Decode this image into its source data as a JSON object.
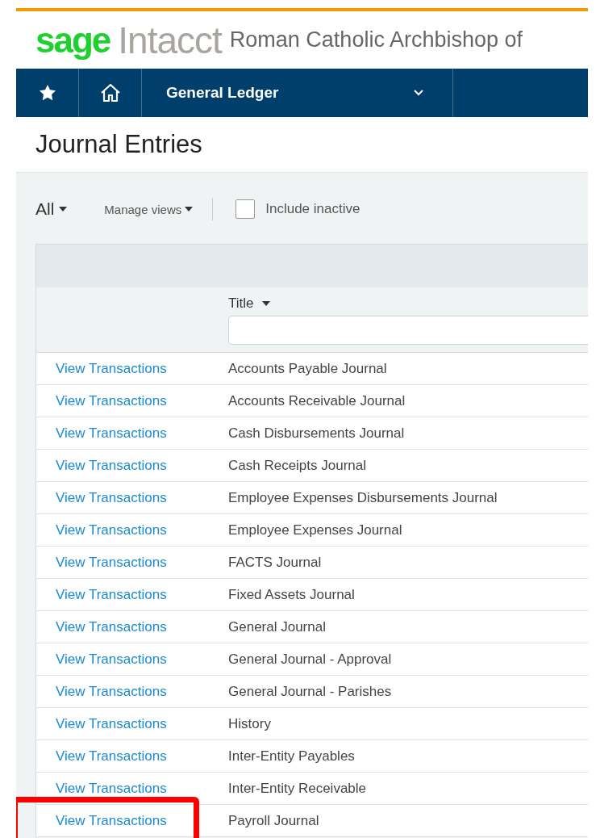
{
  "brand": {
    "logo_primary": "sage",
    "logo_secondary": "Intacct",
    "company": "Roman Catholic Archbishop of"
  },
  "nav": {
    "module": "General Ledger"
  },
  "page_title": "Journal Entries",
  "toolbar": {
    "view": "All",
    "manage_views": "Manage views",
    "include_inactive": {
      "label": "Include inactive",
      "checked": false
    }
  },
  "table": {
    "columns": [
      {
        "label": "Title"
      }
    ],
    "rows": [
      {
        "action": "View Transactions",
        "title": "Accounts Payable Journal",
        "highlighted": false
      },
      {
        "action": "View Transactions",
        "title": "Accounts Receivable Journal",
        "highlighted": false
      },
      {
        "action": "View Transactions",
        "title": "Cash Disbursements Journal",
        "highlighted": false
      },
      {
        "action": "View Transactions",
        "title": "Cash Receipts Journal",
        "highlighted": false
      },
      {
        "action": "View Transactions",
        "title": "Employee Expenses Disbursements Journal",
        "highlighted": false
      },
      {
        "action": "View Transactions",
        "title": "Employee Expenses Journal",
        "highlighted": false
      },
      {
        "action": "View Transactions",
        "title": "FACTS Journal",
        "highlighted": false
      },
      {
        "action": "View Transactions",
        "title": "Fixed Assets Journal",
        "highlighted": false
      },
      {
        "action": "View Transactions",
        "title": "General Journal",
        "highlighted": false
      },
      {
        "action": "View Transactions",
        "title": "General Journal - Approval",
        "highlighted": false
      },
      {
        "action": "View Transactions",
        "title": "General Journal - Parishes",
        "highlighted": false
      },
      {
        "action": "View Transactions",
        "title": "History",
        "highlighted": false
      },
      {
        "action": "View Transactions",
        "title": "Inter-Entity Payables",
        "highlighted": false
      },
      {
        "action": "View Transactions",
        "title": "Inter-Entity Receivable",
        "highlighted": false
      },
      {
        "action": "View Transactions",
        "title": "Payroll Journal",
        "highlighted": true
      }
    ]
  }
}
